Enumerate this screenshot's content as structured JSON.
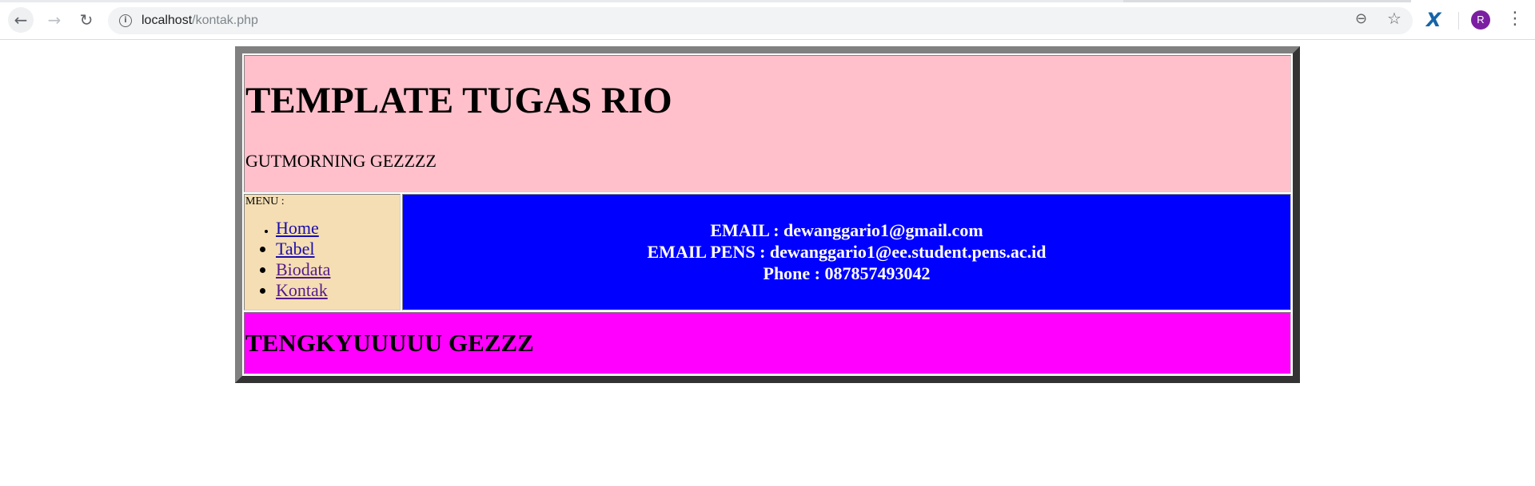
{
  "browser": {
    "url_host": "localhost",
    "url_path": "/kontak.php",
    "profile_initial": "R",
    "icons": {
      "back": "arrow-left-icon",
      "forward": "arrow-right-icon",
      "reload": "reload-icon",
      "site_info": "info-icon",
      "zoom": "zoom-icon",
      "bookmark": "star-icon",
      "extension": "x-extension-icon",
      "menu": "kebab-menu-icon"
    }
  },
  "page": {
    "title": "TEMPLATE TUGAS RIO",
    "subtitle": "GUTMORNING GEZZZZ",
    "menu_label": "MENU :",
    "menu_items": [
      {
        "label": "Home"
      },
      {
        "label": "Tabel"
      },
      {
        "label": "Biodata"
      },
      {
        "label": "Kontak"
      }
    ],
    "contact": {
      "email": "EMAIL : dewanggario1@gmail.com",
      "email_pens": "EMAIL PENS : dewanggario1@ee.student.pens.ac.id",
      "phone": "Phone : 087857493042"
    },
    "footer": "TENGKYUUUUU GEZZZ",
    "colors": {
      "header_bg": "#ffc0cb",
      "sidebar_bg": "#f5deb3",
      "content_bg": "#0000ff",
      "footer_bg": "#ff00ff",
      "link": "#1a0dab",
      "visited_link": "#551a8b"
    }
  }
}
